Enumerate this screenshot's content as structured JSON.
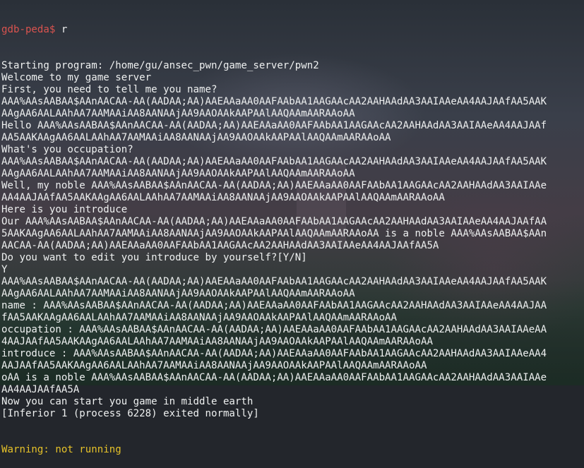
{
  "terminal": {
    "prompt": "gdb-peda$",
    "command": "r",
    "lines": [
      "Starting program: /home/gu/ansec_pwn/game_server/pwn2",
      "Welcome to my game server",
      "First, you need to tell me you name?",
      "AAA%AAsAABAA$AAnAACAA-AA(AADAA;AA)AAEAAaAA0AAFAAbAA1AAGAAcAA2AAHAAdAA3AAIAAeAA4AAJAAfAA5AAK",
      "AAgAA6AALAAhAA7AAMAAiAA8AANAAjAA9AAOAAkAAPAAlAAQAAmAARAAoAA",
      "Hello AAA%AAsAABAA$AAnAACAA-AA(AADAA;AA)AAEAAaAA0AAFAAbAA1AAGAAcAA2AAHAAdAA3AAIAAeAA4AAJAAf",
      "AA5AAKAAgAA6AALAAhAA7AAMAAiAA8AANAAjAA9AAOAAkAAPAAlAAQAAmAARAAoAA",
      "What's you occupation?",
      "AAA%AAsAABAA$AAnAACAA-AA(AADAA;AA)AAEAAaAA0AAFAAbAA1AAGAAcAA2AAHAAdAA3AAIAAeAA4AAJAAfAA5AAK",
      "AAgAA6AALAAhAA7AAMAAiAA8AANAAjAA9AAOAAkAAPAAlAAQAAmAARAAoAA",
      "Well, my noble AAA%AAsAABAA$AAnAACAA-AA(AADAA;AA)AAEAAaAA0AAFAAbAA1AAGAAcAA2AAHAAdAA3AAIAAe",
      "AA4AAJAAfAA5AAKAAgAA6AALAAhAA7AAMAAiAA8AANAAjAA9AAOAAkAAPAAlAAQAAmAARAAoAA",
      "Here is you introduce",
      "Our AAA%AAsAABAA$AAnAACAA-AA(AADAA;AA)AAEAAaAA0AAFAAbAA1AAGAAcAA2AAHAAdAA3AAIAAeAA4AAJAAfAA",
      "5AAKAAgAA6AALAAhAA7AAMAAiAA8AANAAjAA9AAOAAkAAPAAlAAQAAmAARAAoAA is a noble AAA%AAsAABAA$AAn",
      "AACAA-AA(AADAA;AA)AAEAAaAA0AAFAAbAA1AAGAAcAA2AAHAAdAA3AAIAAeAA4AAJAAfAA5A",
      "Do you want to edit you introduce by yourself?[Y/N]",
      "Y",
      "AAA%AAsAABAA$AAnAACAA-AA(AADAA;AA)AAEAAaAA0AAFAAbAA1AAGAAcAA2AAHAAdAA3AAIAAeAA4AAJAAfAA5AAK",
      "AAgAA6AALAAhAA7AAMAAiAA8AANAAjAA9AAOAAkAAPAAlAAQAAmAARAAoAA",
      "name : AAA%AAsAABAA$AAnAACAA-AA(AADAA;AA)AAEAAaAA0AAFAAbAA1AAGAAcAA2AAHAAdAA3AAIAAeAA4AAJAA",
      "fAA5AAKAAgAA6AALAAhAA7AAMAAiAA8AANAAjAA9AAOAAkAAPAAlAAQAAmAARAAoAA",
      "occupation : AAA%AAsAABAA$AAnAACAA-AA(AADAA;AA)AAEAAaAA0AAFAAbAA1AAGAAcAA2AAHAAdAA3AAIAAeAA",
      "4AAJAAfAA5AAKAAgAA6AALAAhAA7AAMAAiAA8AANAAjAA9AAOAAkAAPAAlAAQAAmAARAAoAA",
      "introduce : AAA%AAsAABAA$AAnAACAA-AA(AADAA;AA)AAEAAaAA0AAFAAbAA1AAGAAcAA2AAHAAdAA3AAIAAeAA4",
      "AAJAAfAA5AAKAAgAA6AALAAhAA7AAMAAiAA8AANAAjAA9AAOAAkAAPAAlAAQAAmAARAAoAA",
      "oAA is a noble AAA%AAsAABAA$AAnAACAA-AA(AADAA;AA)AAEAAaAA0AAFAAbAA1AAGAAcAA2AAHAAdAA3AAIAAe",
      "AA4AAJAAfAA5A",
      "Now you can start you game in middle earth",
      "[Inferior 1 (process 6228) exited normally]"
    ],
    "warning": "Warning: not running"
  },
  "colors": {
    "background": "#23262c",
    "text": "#eef0f0",
    "prompt": "#d9534f",
    "warning": "#e6c229"
  }
}
